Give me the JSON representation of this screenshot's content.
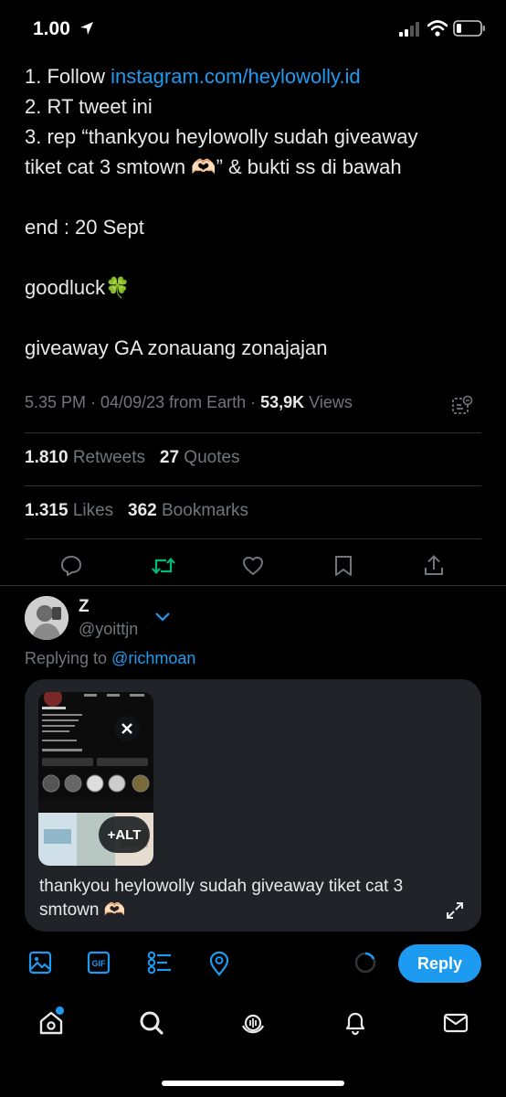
{
  "status_bar": {
    "time": "1.00"
  },
  "tweet": {
    "lines": [
      {
        "prefix": "1. Follow ",
        "link": "instagram.com/heylowolly.id"
      },
      {
        "text": "2. RT tweet ini"
      },
      {
        "text": "3. rep “thankyou heylowolly sudah giveaway"
      },
      {
        "text": "tiket cat 3 smtown 🫶🏻” & bukti ss di bawah"
      },
      {
        "text": "end : 20 Sept"
      },
      {
        "text": "goodluck🍀"
      },
      {
        "text": "giveaway GA zonauang zonajajan"
      }
    ],
    "meta_prefix": "5.35 PM · 04/09/23 from Earth · ",
    "views_count": "53,9K",
    "views_label": " Views"
  },
  "stats": {
    "retweets_count": "1.810",
    "retweets_label": " Retweets",
    "quotes_count": "27",
    "quotes_label": " Quotes",
    "likes_count": "1.315",
    "likes_label": " Likes",
    "bookmarks_count": "362",
    "bookmarks_label": " Bookmarks"
  },
  "reply": {
    "name": "Z",
    "handle": "@yoittjn",
    "replying_prefix": "Replying to ",
    "replying_handle": "@richmoan",
    "alt_label": "+ALT",
    "draft_text": "thankyou heylowolly sudah giveaway tiket cat 3 smtown 🫶🏻",
    "reply_button": "Reply"
  },
  "colors": {
    "accent": "#1d9bf0",
    "retweet_green": "#00ba7c",
    "muted": "#71767b"
  },
  "icons": [
    "location-arrow-icon",
    "cellular-icon",
    "wifi-icon",
    "battery-icon",
    "grok-icon",
    "comment-icon",
    "retweet-icon",
    "like-icon",
    "bookmark-icon",
    "share-icon",
    "chevron-down-icon",
    "close-icon",
    "expand-icon",
    "image-icon",
    "gif-icon",
    "poll-icon",
    "location-icon",
    "progress-ring-icon",
    "home-icon",
    "search-icon",
    "spaces-icon",
    "notifications-icon",
    "messages-icon"
  ]
}
